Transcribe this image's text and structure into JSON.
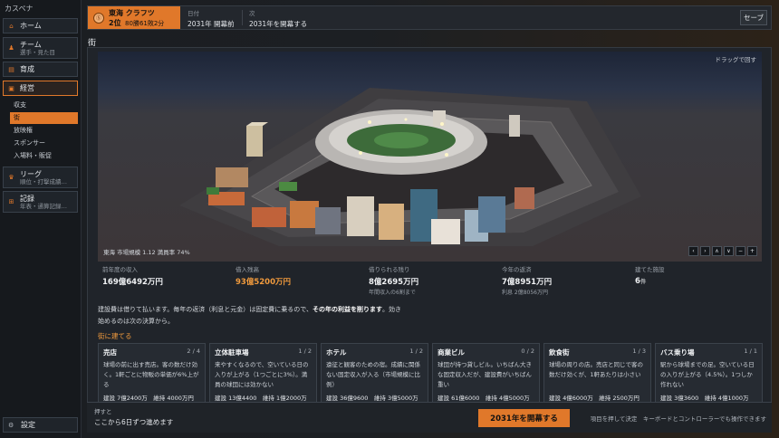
{
  "app_title": "カスペナ",
  "sidebar": {
    "items": [
      {
        "label": "ホーム",
        "sub": ""
      },
      {
        "label": "チーム",
        "sub": "選手・見た目"
      },
      {
        "label": "育成",
        "sub": ""
      },
      {
        "label": "経営",
        "sub": ""
      },
      {
        "label": "リーグ",
        "sub": "順位・打撃成績…"
      },
      {
        "label": "記録",
        "sub": "年表・通算記録…"
      }
    ],
    "sub_items": [
      "収支",
      "街",
      "放映権",
      "スポンサー",
      "入場料・販促"
    ],
    "settings": "設定"
  },
  "topbar": {
    "team_logo": "Ⓢ",
    "team_name": "東海 クラフツ",
    "rank": "2位",
    "record": "80勝61敗2分",
    "date_label": "日付",
    "date_value": "2031年  開幕前",
    "next_label": "次",
    "next_value": "2031年を開幕する",
    "save": "セーブ"
  },
  "section_title": "街",
  "scene": {
    "drag_hint": "ドラッグで回す",
    "info": "東海    市場規模 1.12    満員率 74%",
    "controls": [
      "‹",
      "›",
      "∧",
      "∨",
      "−",
      "+"
    ]
  },
  "stats": [
    {
      "label": "前年度の収入",
      "value": "169億6492万円",
      "note": "",
      "orange": false
    },
    {
      "label": "借入残高",
      "value": "93億5200万円",
      "note": "",
      "orange": true
    },
    {
      "label": "借りられる残り",
      "value": "8億2695万円",
      "note": "年間収入の6割まで",
      "orange": false
    },
    {
      "label": "今年の返済",
      "value": "7億8951万円",
      "note": "利息 2億8056万円",
      "orange": false
    },
    {
      "label": "建てた施設",
      "value": "6",
      "unit": "件",
      "note": "",
      "orange": false
    }
  ],
  "desc": {
    "line1": "建設費は借りて払います。毎年の返済（利息と元金）は固定費に乗るので、",
    "bold": "その年の利益を削ります",
    "line1_end": "。効き",
    "line2": "始めるのは次の決算から。"
  },
  "build_head": "街に建てる",
  "cards": [
    {
      "name": "売店",
      "count": "2 / 4",
      "desc": "球場の前に出す売店。客の数だけ効く。1軒ごとに物販の単価が6%上がる",
      "cost": "建設 7億2400万",
      "upkeep": "維持 4000万円"
    },
    {
      "name": "立体駐車場",
      "count": "1 / 2",
      "desc": "来やすくなるので、空いている日の入りが上がる（1つごとに3%）。満員の球団には効かない",
      "cost": "建設 13億4400",
      "upkeep": "維持 1億2000万"
    },
    {
      "name": "ホテル",
      "count": "1 / 2",
      "desc": "遠征と観客のための宿。成績に関係ない固定収入が入る（市場規模に比例）",
      "cost": "建設 36億9600",
      "upkeep": "維持 3億5000万"
    },
    {
      "name": "商業ビル",
      "count": "0 / 2",
      "desc": "球団が持つ貸しビル。いちばん大きな固定収入だが、建設費がいちばん重い",
      "cost": "建設 61億6000",
      "upkeep": "維持 4億5000万"
    },
    {
      "name": "飲食街",
      "count": "1 / 3",
      "desc": "球場の周りの店。売店と同じで客の数だけ効くが、1軒あたりは小さい",
      "cost": "建設 4億6000万",
      "upkeep": "維持 2500万円"
    },
    {
      "name": "バス乗り場",
      "count": "1 / 1",
      "desc": "駅から球場までの足。空いている日の入りが上がる（4.5%）。1つしか作れない",
      "cost": "建設 3億3600",
      "upkeep": "維持 4億1000万"
    }
  ],
  "footer": {
    "label": "押すと",
    "text": "ここから6日ずつ進めます",
    "button": "2031年を開幕する",
    "hint": "項目を押して決定　キーボードとコントローラーでも操作できます"
  }
}
